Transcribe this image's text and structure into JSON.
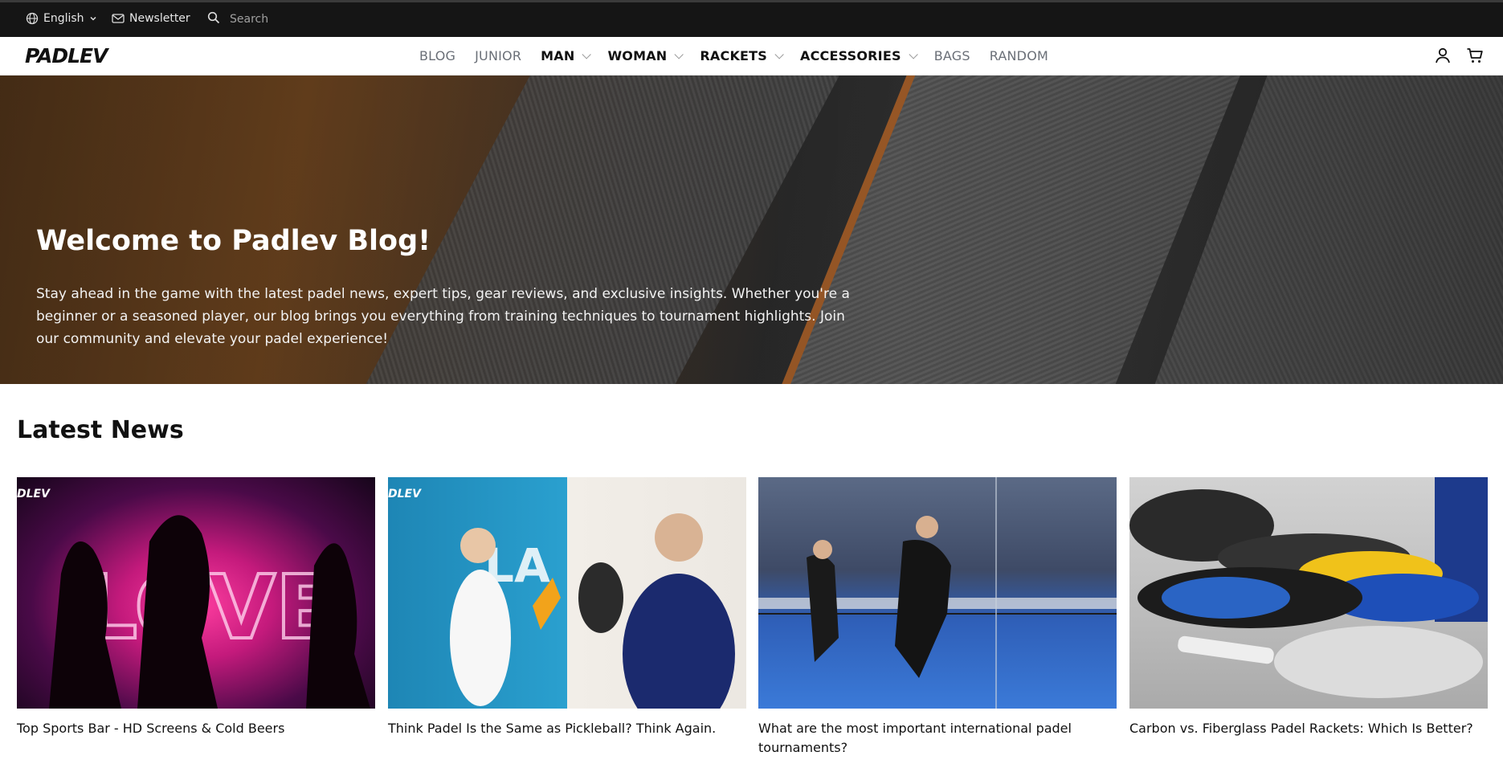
{
  "topbar": {
    "language": "English",
    "newsletter": "Newsletter",
    "search_placeholder": "Search"
  },
  "nav": {
    "logo": "PADLEV",
    "items": [
      {
        "label": "BLOG",
        "bold": false,
        "dropdown": false
      },
      {
        "label": "JUNIOR",
        "bold": false,
        "dropdown": false
      },
      {
        "label": "MAN",
        "bold": true,
        "dropdown": true
      },
      {
        "label": "WOMAN",
        "bold": true,
        "dropdown": true
      },
      {
        "label": "RACKETS",
        "bold": true,
        "dropdown": true
      },
      {
        "label": "ACCESSORIES",
        "bold": true,
        "dropdown": true
      },
      {
        "label": "BAGS",
        "bold": false,
        "dropdown": false
      },
      {
        "label": "RANDOM",
        "bold": false,
        "dropdown": false
      }
    ]
  },
  "hero": {
    "title": "Welcome to Padlev Blog!",
    "text": "Stay ahead in the game with the latest padel news, expert tips, gear reviews, and exclusive insights. Whether you're a beginner or a seasoned player, our blog brings you everything from training techniques to tournament highlights. Join our community and elevate your padel experience!"
  },
  "news": {
    "title": "Latest News",
    "cards": [
      {
        "title": "Top Sports Bar - HD Screens & Cold Beers",
        "brand": "DLEV"
      },
      {
        "title": "Think Padel Is the Same as Pickleball? Think Again.",
        "brand": "DLEV"
      },
      {
        "title": "What are the most important international padel tournaments?",
        "brand": ""
      },
      {
        "title": "Carbon vs. Fiberglass Padel Rackets: Which Is Better?",
        "brand": ""
      }
    ]
  }
}
